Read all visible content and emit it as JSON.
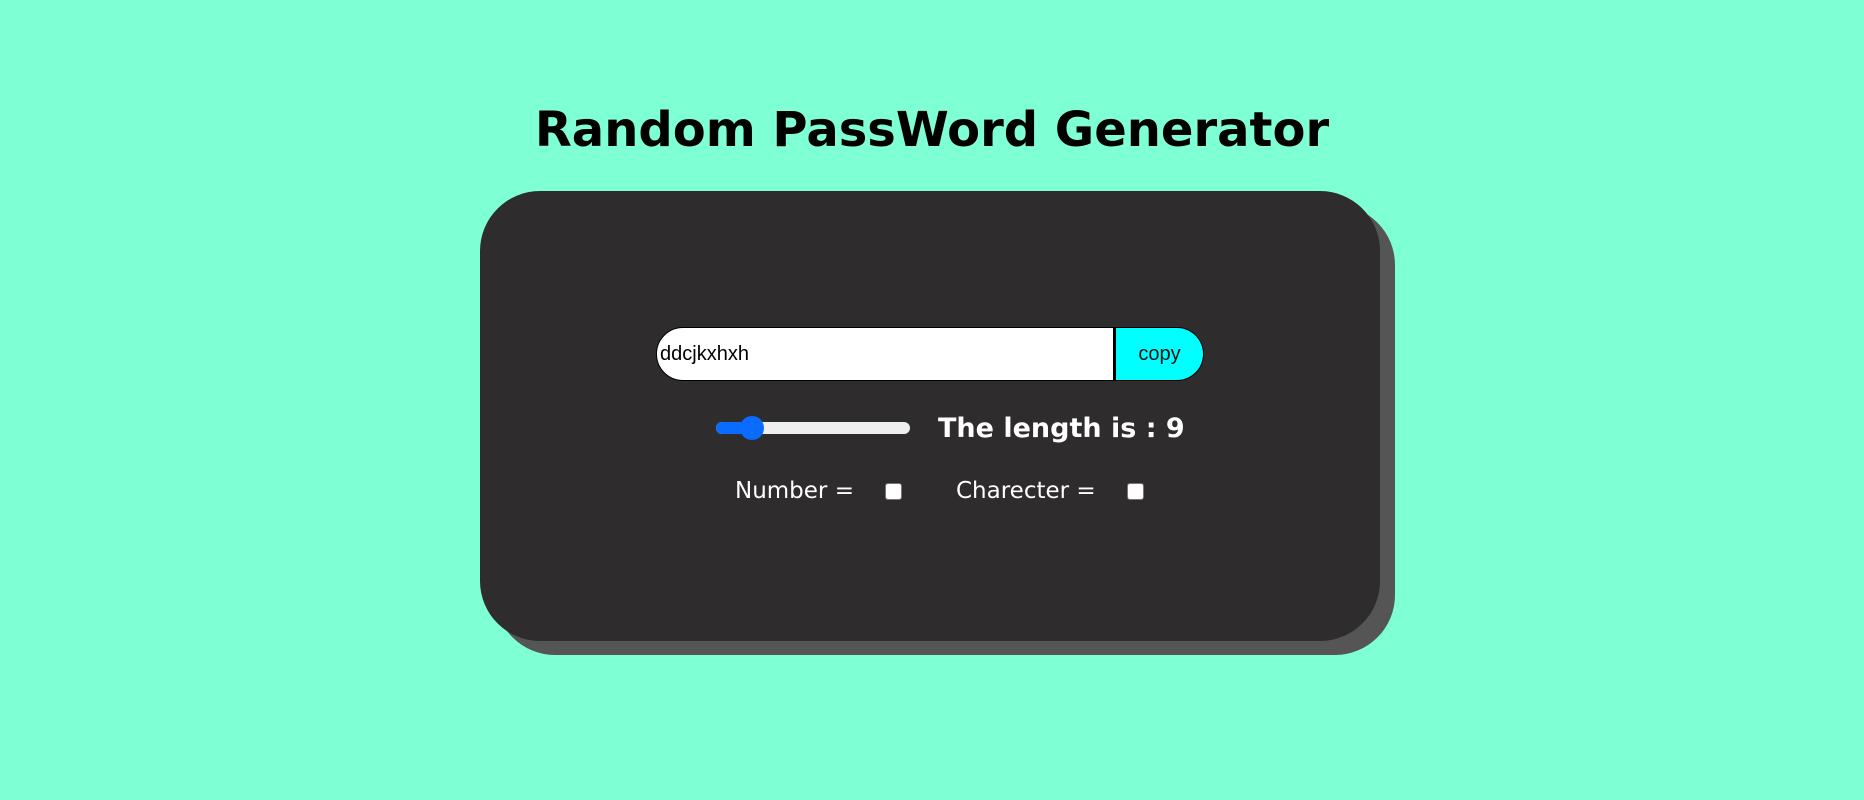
{
  "page": {
    "title": "Random PassWord Generator",
    "background": "#7fffd4"
  },
  "generator": {
    "password_value": "ddcjkxhxh",
    "copy_label": "copy",
    "copy_color": "#00ffff",
    "length_label": "The length is : 9",
    "length": 9,
    "length_fraction": 0.14,
    "slider_color": "#0a6cff",
    "card_color": "#2e2c2d",
    "options": {
      "number_label": "Number =",
      "number_checked": false,
      "character_label": "Charecter =",
      "character_checked": false
    }
  }
}
